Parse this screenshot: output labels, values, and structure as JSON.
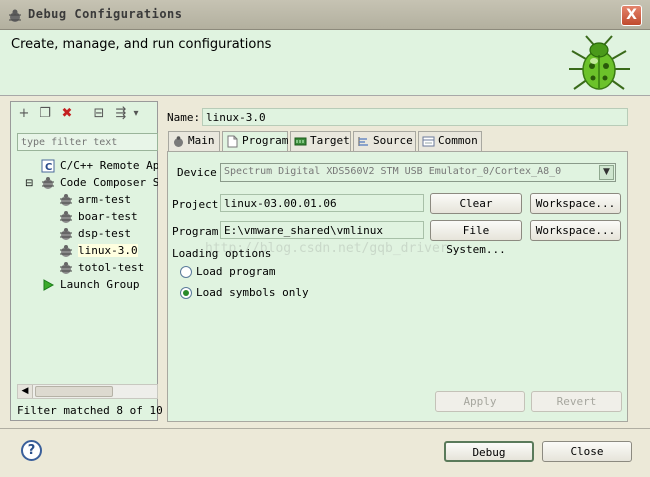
{
  "window": {
    "title": "Debug Configurations",
    "close_glyph": "X"
  },
  "header": {
    "title": "Create, manage, and run configurations",
    "icon": "bug-icon"
  },
  "left": {
    "toolbar": [
      {
        "name": "new-configuration-icon",
        "glyph": "+"
      },
      {
        "name": "duplicate-icon",
        "glyph": "❐"
      },
      {
        "name": "delete-icon",
        "glyph": "✖"
      },
      {
        "name": "collapse-all-icon",
        "glyph": "⊟"
      },
      {
        "name": "filter-icon",
        "glyph": "⇶"
      },
      {
        "name": "dropdown-arrow-icon",
        "glyph": "▾"
      }
    ],
    "filter_placeholder": "type filter text",
    "tree": [
      {
        "label": "C/C++ Remote Appl",
        "level": 1,
        "icon": "c-remote-app-icon",
        "expander": ""
      },
      {
        "label": "Code Composer St",
        "level": 1,
        "icon": "code-composer-icon",
        "expander": "⊟"
      },
      {
        "label": "arm-test",
        "level": 2,
        "icon": "debug-config-icon",
        "expander": ""
      },
      {
        "label": "boar-test",
        "level": 2,
        "icon": "debug-config-icon",
        "expander": ""
      },
      {
        "label": "dsp-test",
        "level": 2,
        "icon": "debug-config-icon",
        "expander": ""
      },
      {
        "label": "linux-3.0",
        "level": 2,
        "icon": "debug-config-icon",
        "expander": "",
        "selected": true
      },
      {
        "label": "totol-test",
        "level": 2,
        "icon": "debug-config-icon",
        "expander": ""
      },
      {
        "label": "Launch Group",
        "level": 1,
        "icon": "launch-group-icon",
        "expander": ""
      }
    ],
    "filter_status": "Filter matched 8 of 10"
  },
  "config": {
    "name_label": "Name:",
    "name_value": "linux-3.0",
    "tabs": [
      {
        "label": "Main",
        "icon": "main-tab-icon"
      },
      {
        "label": "Program",
        "icon": "program-tab-icon",
        "active": true
      },
      {
        "label": "Target",
        "icon": "target-tab-icon"
      },
      {
        "label": "Source",
        "icon": "source-tab-icon"
      },
      {
        "label": "Common",
        "icon": "common-tab-icon"
      }
    ],
    "device_label": "Device",
    "device_value": "Spectrum Digital XDS560V2 STM USB Emulator_0/Cortex_A8_0",
    "project_label": "Project",
    "project_value": "linux-03.00.01.06",
    "clear_button": "Clear",
    "workspace_button": "Workspace...",
    "program_label": "Program",
    "program_value": "E:\\vmware_shared\\vmlinux",
    "file_system_button": "File System...",
    "loading_options_label": "Loading options",
    "load_program_label": "Load program",
    "load_symbols_label": "Load symbols only",
    "selected_loading_option": "Load symbols only",
    "apply_button": "Apply",
    "revert_button": "Revert",
    "watermark": "http://blog.csdn.net/gqb_driver"
  },
  "footer": {
    "help_glyph": "?",
    "debug_button": "Debug",
    "close_button": "Close"
  },
  "colors": {
    "panel_green": "#e0f3e0",
    "dialog_bg": "#ece9d8",
    "close_red": "#c04a2d"
  }
}
